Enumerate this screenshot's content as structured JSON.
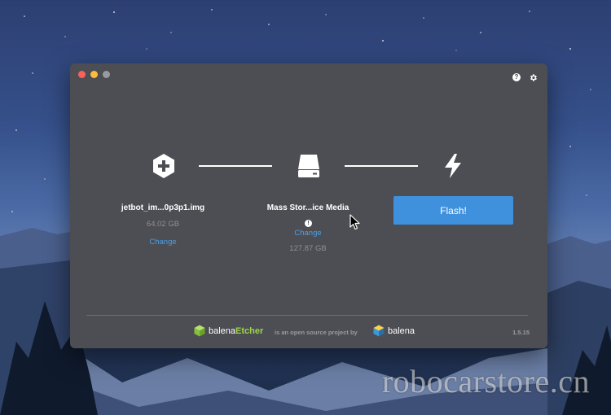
{
  "window": {
    "title_buttons": [
      "close",
      "minimize",
      "maximize"
    ],
    "help_icon_glyph": "?"
  },
  "steps": {
    "image": {
      "icon": "plus-hexagon-icon",
      "filename": "jetbot_im...0p3p1.img",
      "size": "64.02 GB",
      "change_label": "Change"
    },
    "drive": {
      "icon": "hard-drive-icon",
      "name": "Mass Stor...ice Media",
      "warning_glyph": "!",
      "change_label": "Change",
      "size": "127.87 GB"
    },
    "flash": {
      "icon": "lightning-bolt-icon",
      "button_label": "Flash!"
    }
  },
  "footer": {
    "brand_prefix": "balena",
    "brand_suffix": "Etcher",
    "tagline": "is an open source project by",
    "company": "balena",
    "version": "1.5.15"
  },
  "watermark": "robocarstore.cn",
  "colors": {
    "window_bg": "#4d4e53",
    "accent_blue": "#3f91de",
    "link_blue": "#4c9fe4",
    "etcher_green": "#9bd549"
  }
}
